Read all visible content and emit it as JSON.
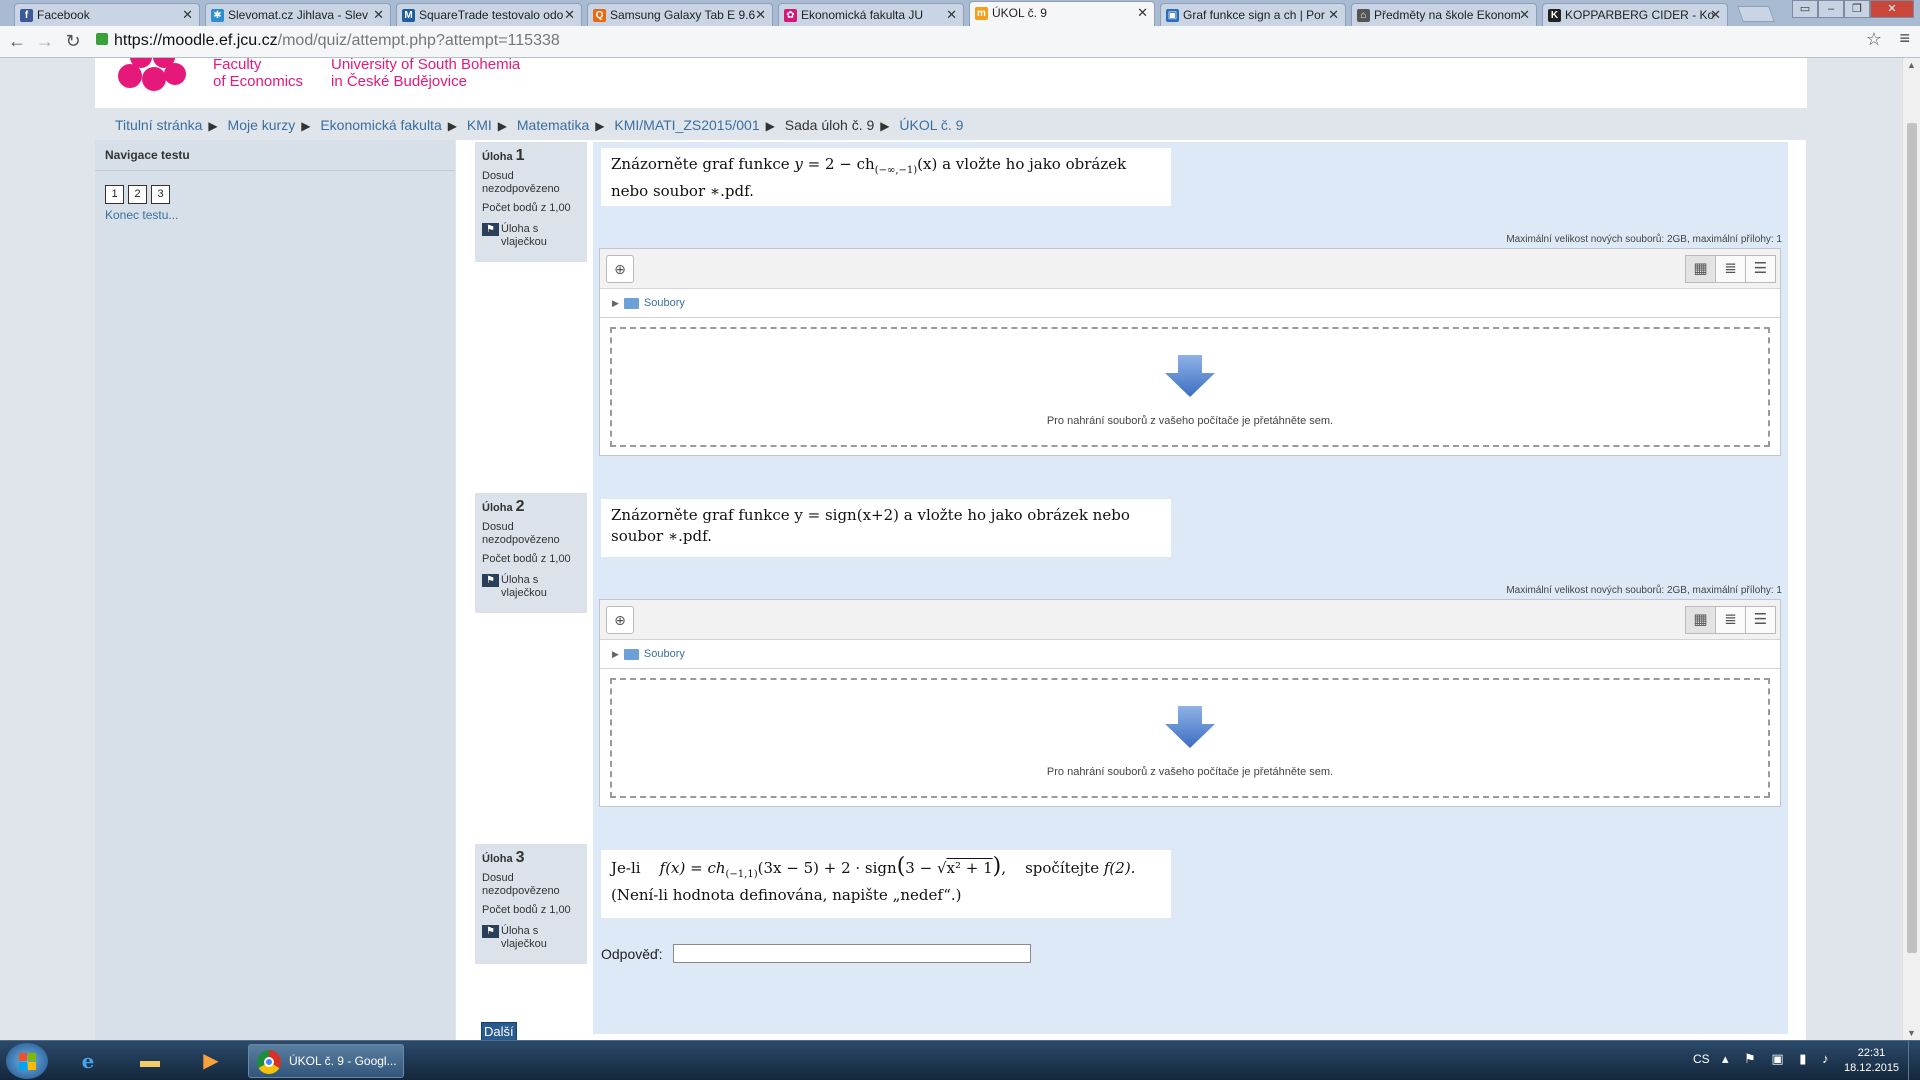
{
  "browser": {
    "tabs": [
      {
        "label": "Facebook",
        "icon_color": "#3b5998",
        "icon_char": "f"
      },
      {
        "label": "Slevomat.cz Jihlava - Slev",
        "icon_color": "#2d8ecf",
        "icon_char": "✱"
      },
      {
        "label": "SquareTrade testovalo odo",
        "icon_color": "#1f5e9e",
        "icon_char": "M"
      },
      {
        "label": "Samsung Galaxy Tab E 9.6",
        "icon_color": "#e86a10",
        "icon_char": "Q"
      },
      {
        "label": "Ekonomická fakulta JU",
        "icon_color": "#d6177a",
        "icon_char": "✿"
      },
      {
        "label": "ÚKOL č. 9",
        "icon_color": "#f2a01a",
        "icon_char": "m"
      },
      {
        "label": "Graf funkce sign a ch | Por",
        "icon_color": "#2a6ebb",
        "icon_char": "▣"
      },
      {
        "label": "Předměty na škole Ekonom",
        "icon_color": "#555555",
        "icon_char": "⌂"
      },
      {
        "label": "KOPPARBERG CIDER - Kop",
        "icon_color": "#222222",
        "icon_char": "K"
      }
    ],
    "active_tab": "ÚKOL č. 9",
    "url_host": "https://moodle.ef.jcu.cz",
    "url_path": "/mod/quiz/attempt.php?attempt=115338"
  },
  "header": {
    "faculty_line1": "Faculty",
    "faculty_line2": "of Economics",
    "university_line1": "University of South Bohemia",
    "university_line2": "in České Budějovice",
    "brand_color": "#e6197a"
  },
  "breadcrumb": [
    {
      "label": "Titulní stránka",
      "link": true
    },
    {
      "label": "Moje kurzy",
      "link": true
    },
    {
      "label": "Ekonomická fakulta",
      "link": true
    },
    {
      "label": "KMI",
      "link": true
    },
    {
      "label": "Matematika",
      "link": true
    },
    {
      "label": "KMI/MATI_ZS2015/001",
      "link": true
    },
    {
      "label": "Sada úloh č. 9",
      "link": false
    },
    {
      "label": "ÚKOL č. 9",
      "link": true
    }
  ],
  "breadcrumb_separator": "▶",
  "quiz_nav": {
    "title": "Navigace testu",
    "question_numbers": [
      "1",
      "2",
      "3"
    ],
    "finish_link": "Konec testu..."
  },
  "questions": [
    {
      "prefix": "Úloha",
      "number": "1",
      "status": "Dosud nezodpovězeno",
      "points": "Počet bodů z 1,00",
      "flag_label": "Úloha s vlaječkou",
      "max_size": "Maximální velikost nových souborů: 2GB, maximální přílohy: 1",
      "folder_label": "Soubory",
      "drop_text": "Pro nahrání souborů z vašeho počítače je přetáhněte sem."
    },
    {
      "prefix": "Úloha",
      "number": "2",
      "status": "Dosud nezodpovězeno",
      "points": "Počet bodů z 1,00",
      "flag_label": "Úloha s vlaječkou",
      "text": "Znázorněte graf funkce y = sign(x+2) a vložte ho jako obrázek nebo soubor ∗.pdf.",
      "max_size": "Maximální velikost nových souborů: 2GB, maximální přílohy: 1",
      "folder_label": "Soubory",
      "drop_text": "Pro nahrání souborů z vašeho počítače je přetáhněte sem."
    },
    {
      "prefix": "Úloha",
      "number": "3",
      "status": "Dosud nezodpovězeno",
      "points": "Počet bodů z 1,00",
      "flag_label": "Úloha s vlaječkou",
      "answer_label": "Odpověď:",
      "answer_value": ""
    }
  ],
  "q1_text": {
    "part1": "Znázorněte graf funkce ",
    "y": "y",
    "eq": " = 2 − ch",
    "sub": "(−∞,−1)",
    "arg": "(x)",
    "part2": " a vložte ho jako obrázek nebo soubor ∗.pdf."
  },
  "q3_text": {
    "prefix": "Je-li",
    "f": "f(x) = ch",
    "sub": "(−1,1)",
    "mid": "(3x − 5) + 2 · sign",
    "inner": "3 − ",
    "radicand": "x² + 1",
    "tail": ",",
    "compute": "spočítejte",
    "f2": "f(2).",
    "note": "(Není-li hodnota definována, napište „nedef“.)"
  },
  "next_button": "Další",
  "taskbar": {
    "chrome_label": "ÚKOL č. 9 - Googl...",
    "lang": "CS",
    "time": "22:31",
    "date": "18.12.2015"
  }
}
